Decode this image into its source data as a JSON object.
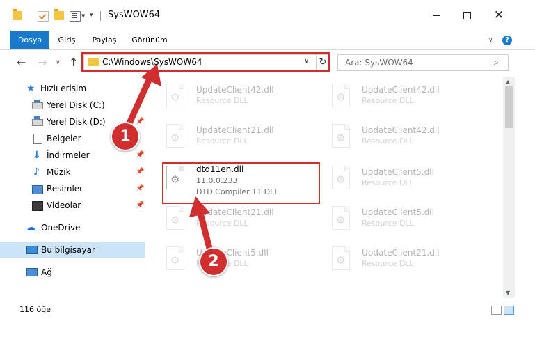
{
  "window": {
    "title": "SysWOW64"
  },
  "ribbon": {
    "tabs": [
      "Dosya",
      "Giriş",
      "Paylaş",
      "Görünüm"
    ],
    "help": "?"
  },
  "nav": {
    "address": "C:\\Windows\\SysWOW64",
    "search_placeholder": "Ara: SysWOW64"
  },
  "sidebar": {
    "items": [
      {
        "label": "Hızlı erişim",
        "icon": "star-icon"
      },
      {
        "label": "Yerel Disk (C:)",
        "icon": "drive-icon"
      },
      {
        "label": "Yerel Disk (D:)",
        "icon": "drive-icon"
      },
      {
        "label": "Belgeler",
        "icon": "documents-icon"
      },
      {
        "label": "İndirmeler",
        "icon": "download-icon"
      },
      {
        "label": "Müzik",
        "icon": "music-icon"
      },
      {
        "label": "Resimler",
        "icon": "pictures-icon"
      },
      {
        "label": "Videolar",
        "icon": "videos-icon"
      },
      {
        "label": "OneDrive",
        "icon": "cloud-icon"
      },
      {
        "label": "Bu bilgisayar",
        "icon": "computer-icon"
      },
      {
        "label": "Ağ",
        "icon": "network-icon"
      }
    ]
  },
  "files": [
    {
      "name": "UpdateClient42.dll",
      "desc": "Resource DLL"
    },
    {
      "name": "UpdateClient42.dll",
      "desc": "Resource DLL"
    },
    {
      "name": "UpdateClient21.dll",
      "desc": "Resource DLL"
    },
    {
      "name": "UpdateClient42.dll",
      "desc": "Resource DLL"
    },
    {
      "name": "dtd11en.dll",
      "version": "11.0.0.233",
      "desc": "DTD Compiler 11 DLL"
    },
    {
      "name": "UpdateClient5.dll",
      "desc": "Resource DLL"
    },
    {
      "name": "UpdateClient21.dll",
      "desc": "Resource DLL"
    },
    {
      "name": "UpdateClient5.dll",
      "desc": "Resource DLL"
    },
    {
      "name": "UpdateClient5.dll",
      "desc": "Resource DLL"
    },
    {
      "name": "UpdateClient21.dll",
      "desc": "Resource DLL"
    }
  ],
  "status": {
    "count": "116 öğe"
  },
  "annotations": {
    "step1": "1",
    "step2": "2",
    "color": "#d12f2f"
  }
}
